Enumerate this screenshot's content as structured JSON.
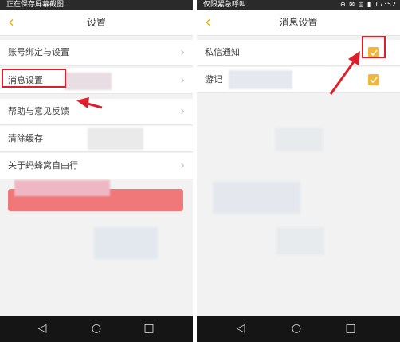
{
  "left_screen": {
    "status_text": "正在保存屏幕截图...",
    "header": {
      "back_icon": "chevron-left-icon",
      "title": "设置"
    },
    "rows": [
      {
        "label": "账号绑定与设置"
      },
      {
        "label": "消息设置"
      },
      {
        "label": "帮助与意见反馈"
      },
      {
        "label": "清除缓存"
      },
      {
        "label": "关于蚂蜂窝自由行"
      }
    ],
    "logout_button_color": "#f07878"
  },
  "right_screen": {
    "status_text": "仅限紧急呼叫",
    "time": "17:52",
    "header": {
      "back_icon": "chevron-left-icon",
      "title": "消息设置"
    },
    "rows": [
      {
        "label": "私信通知",
        "checked": true
      },
      {
        "label": "游记",
        "checked": true
      }
    ]
  },
  "colors": {
    "accent": "#f3b53a",
    "annotation_red": "#e01e2a"
  }
}
